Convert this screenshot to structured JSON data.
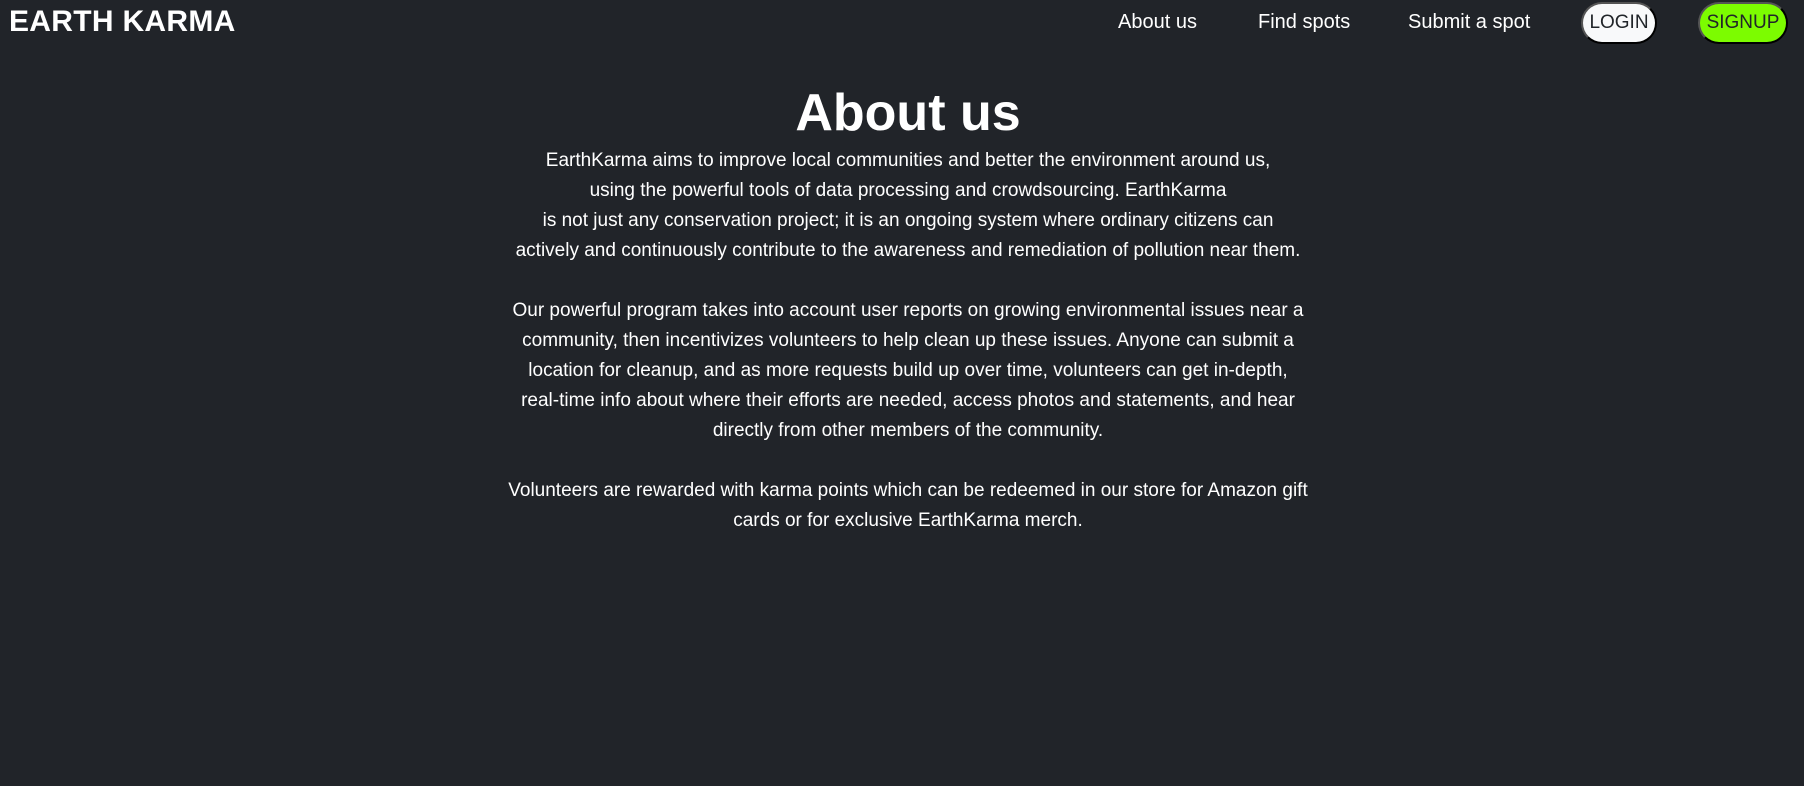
{
  "nav": {
    "brand": "EARTH KARMA",
    "links": [
      {
        "label": "About us"
      },
      {
        "label": "Find spots"
      },
      {
        "label": "Submit a spot"
      }
    ],
    "login_label": "LOGIN",
    "signup_label": "SIGNUP"
  },
  "colors": {
    "background": "#212429",
    "text": "#ffffff",
    "login_bg": "#f8f9fa",
    "signup_bg": "#7cfc00"
  },
  "main": {
    "title": "About us",
    "paragraphs": [
      {
        "lines": [
          "EarthKarma aims to improve local communities and better the environment around us,",
          "using the powerful tools of data processing and crowdsourcing. EarthKarma",
          "is not just any conservation project; it is an ongoing system where ordinary citizens can",
          "actively and continuously contribute to the awareness and remediation of pollution near them."
        ]
      },
      {
        "lines": [
          "Our powerful program takes into account user reports on growing environmental issues near a",
          "community, then incentivizes volunteers to help clean up these issues. Anyone can submit a",
          "location for cleanup, and as more requests build up over time, volunteers can get in-depth,",
          "real-time info about where their efforts are needed, access photos and statements, and hear",
          "directly from other members of the community."
        ]
      },
      {
        "lines": [
          "Volunteers are rewarded with karma points which can be redeemed in our store for Amazon gift",
          "cards or for exclusive EarthKarma merch."
        ]
      }
    ]
  }
}
